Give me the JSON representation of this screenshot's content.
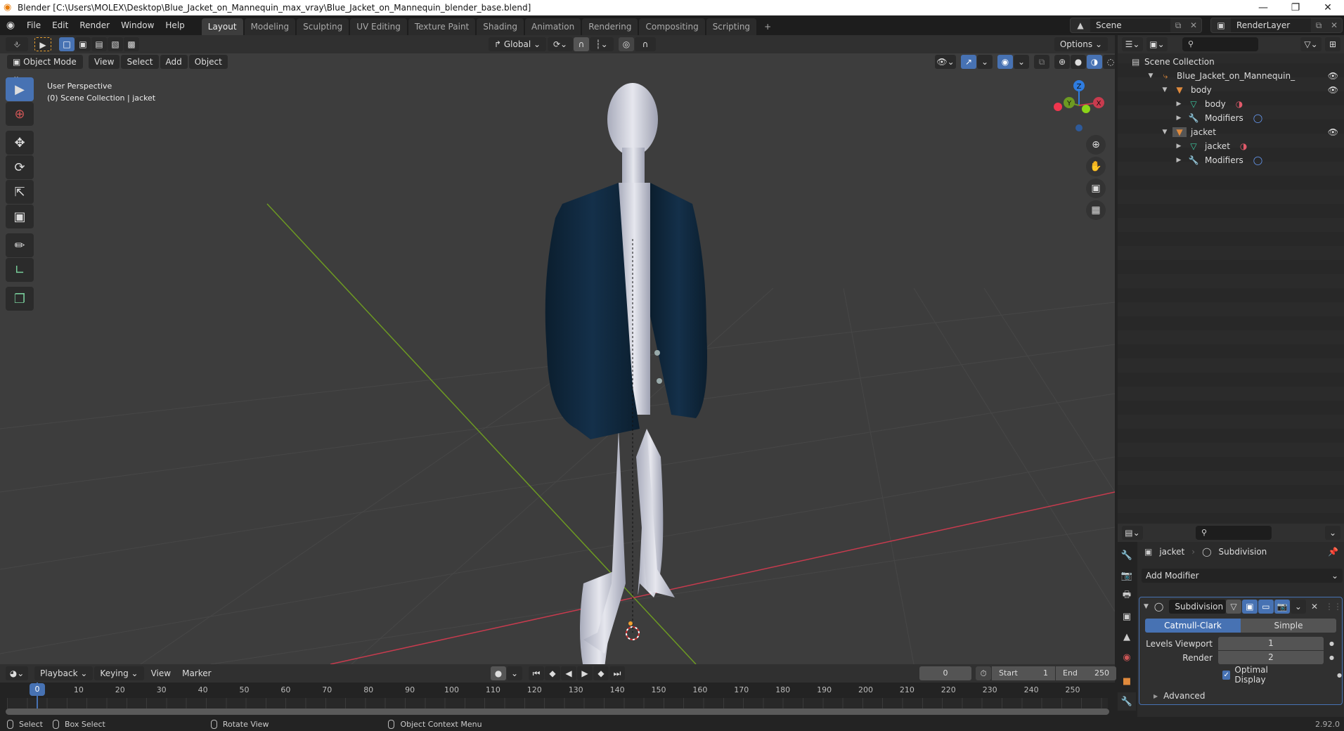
{
  "window": {
    "title": "Blender [C:\\Users\\MOLEX\\Desktop\\Blue_Jacket_on_Mannequin_max_vray\\Blue_Jacket_on_Mannequin_blender_base.blend]",
    "minimize": "—",
    "maximize": "❐",
    "close": "✕"
  },
  "topbar": {
    "menus": [
      "File",
      "Edit",
      "Render",
      "Window",
      "Help"
    ],
    "workspaces": [
      "Layout",
      "Modeling",
      "Sculpting",
      "UV Editing",
      "Texture Paint",
      "Shading",
      "Animation",
      "Rendering",
      "Compositing",
      "Scripting"
    ],
    "active_workspace": "Layout",
    "add_workspace": "+",
    "scene": "Scene",
    "view_layer": "RenderLayer"
  },
  "viewport": {
    "transform_orientation": "Global",
    "options_label": "Options",
    "mode": "Object Mode",
    "menus": [
      "View",
      "Select",
      "Add",
      "Object"
    ],
    "overlay_title": "User Perspective",
    "overlay_subtitle": "(0) Scene Collection | jacket",
    "gizmo": {
      "x": "X",
      "y": "Y",
      "z": "Z"
    },
    "colors": {
      "x_axis": "#c83b4e",
      "y_axis": "#6d9a22",
      "z_axis": "#2e7ce0",
      "accent": "#4772b3",
      "jacket": "#0f2538",
      "mannequin": "#c9cbd6"
    }
  },
  "outliner": {
    "root": "Scene Collection",
    "items": [
      {
        "label": "Blue_Jacket_on_Mannequin_",
        "depth": 1,
        "icon": "empty-icon",
        "expanded": true,
        "eye": true
      },
      {
        "label": "body",
        "depth": 2,
        "icon": "object-mesh-icon",
        "expanded": true,
        "eye": true
      },
      {
        "label": "body",
        "depth": 3,
        "icon": "mesh-data-icon",
        "expanded": false,
        "extra": "material-icon"
      },
      {
        "label": "Modifiers",
        "depth": 3,
        "icon": "wrench-icon",
        "expanded": false,
        "extra": "subdivision-icon"
      },
      {
        "label": "jacket",
        "depth": 2,
        "icon": "object-mesh-icon",
        "expanded": true,
        "eye": true,
        "selected": true
      },
      {
        "label": "jacket",
        "depth": 3,
        "icon": "mesh-data-icon",
        "expanded": false,
        "extra": "material-icon"
      },
      {
        "label": "Modifiers",
        "depth": 3,
        "icon": "wrench-icon",
        "expanded": false,
        "extra": "subdivision-icon"
      }
    ]
  },
  "properties": {
    "breadcrumb_object": "jacket",
    "breadcrumb_modifier": "Subdivision",
    "add_modifier": "Add Modifier",
    "modifier": {
      "name": "Subdivision",
      "type_options": [
        "Catmull-Clark",
        "Simple"
      ],
      "active_type": "Catmull-Clark",
      "levels_viewport_label": "Levels Viewport",
      "levels_viewport": "1",
      "render_label": "Render",
      "render": "2",
      "optimal_display_label": "Optimal Display",
      "optimal_display": true,
      "advanced_label": "Advanced"
    },
    "tabs": [
      "tool",
      "render",
      "output",
      "view-layer",
      "scene",
      "world",
      "object",
      "modifiers"
    ],
    "active_tab": "modifiers"
  },
  "timeline": {
    "menus": [
      "Playback",
      "Keying",
      "View",
      "Marker"
    ],
    "current_frame": "0",
    "start_label": "Start",
    "start": "1",
    "end_label": "End",
    "end": "250",
    "ticks": [
      "0",
      "10",
      "20",
      "30",
      "40",
      "50",
      "60",
      "70",
      "80",
      "90",
      "100",
      "110",
      "120",
      "130",
      "140",
      "150",
      "160",
      "170",
      "180",
      "190",
      "200",
      "210",
      "220",
      "230",
      "240",
      "250"
    ]
  },
  "statusbar": {
    "items": [
      "Select",
      "Box Select",
      "Rotate View",
      "Object Context Menu"
    ],
    "version": "2.92.0"
  }
}
